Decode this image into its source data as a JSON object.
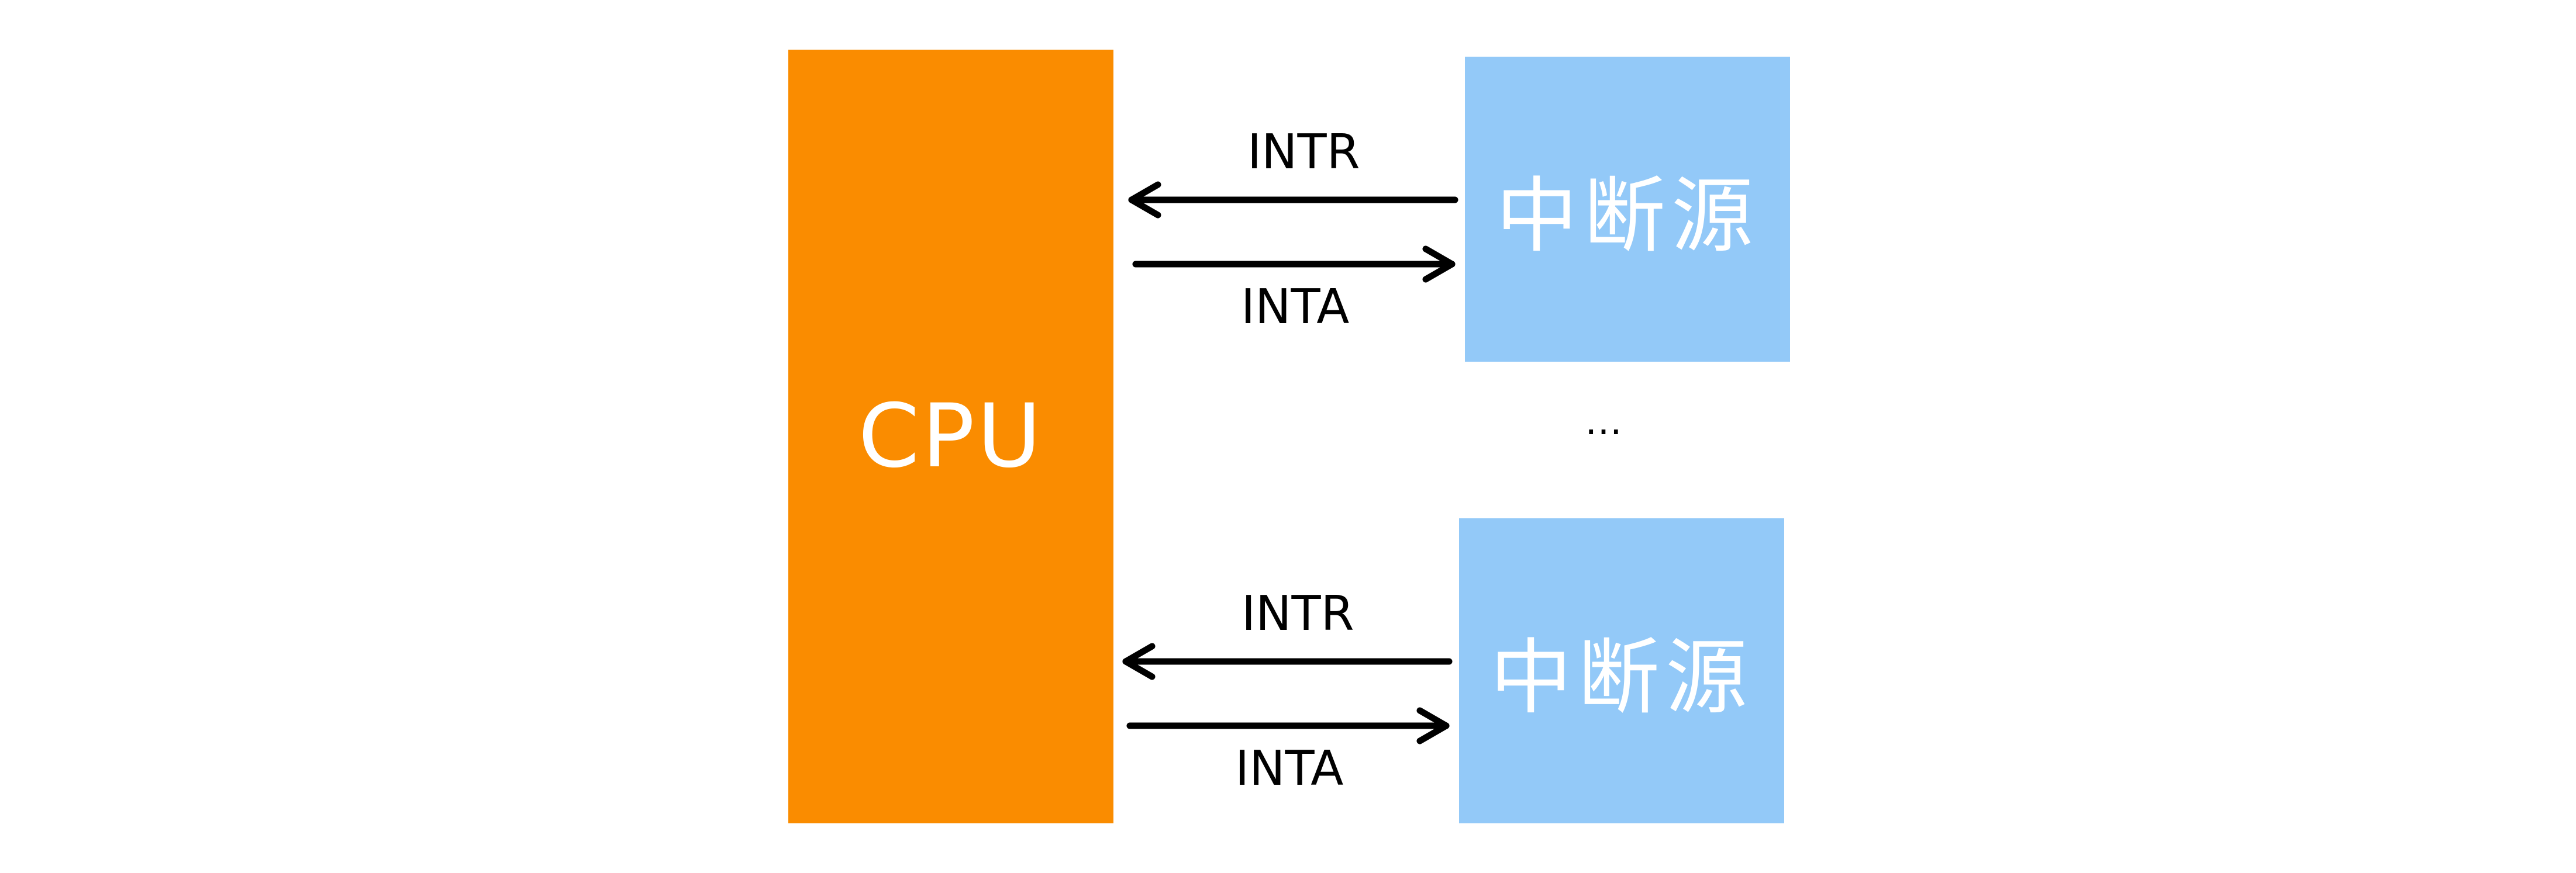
{
  "colors": {
    "cpu_fill": "#FA8C00",
    "source_fill": "#93C9F8",
    "box_text": "#FFFFFF",
    "arrow": "#000000"
  },
  "cpu": {
    "label": "CPU"
  },
  "sources": [
    {
      "label": "中断源",
      "intr_label": "INTR",
      "inta_label": "INTA"
    },
    {
      "label": "中断源",
      "intr_label": "INTR",
      "inta_label": "INTA"
    }
  ],
  "ellipsis": "…"
}
